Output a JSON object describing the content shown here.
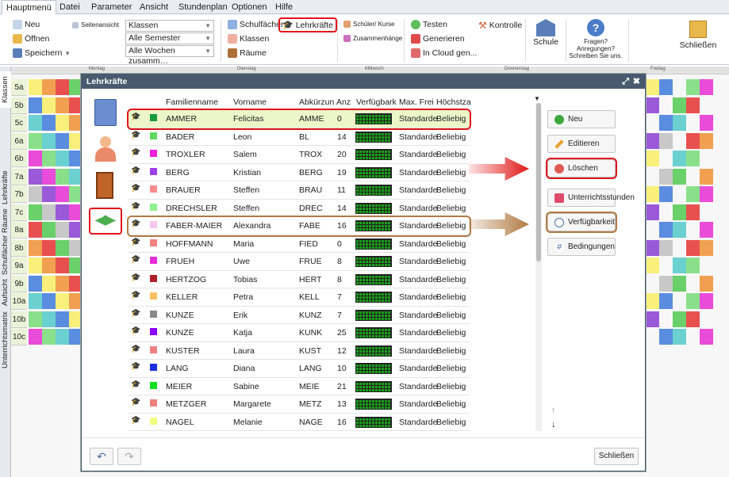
{
  "menubar": {
    "items": [
      "Hauptmenü",
      "Datei",
      "Parameter",
      "Ansicht",
      "Stundenplan",
      "Optionen",
      "Hilfe"
    ]
  },
  "ribbon": {
    "neu": "Neu",
    "seitenansicht": "Seitenansicht",
    "oeffnen": "Öffnen",
    "speichern": "Speichern",
    "select_view": "Klassen",
    "select_semester": "Alle Semester",
    "select_weeks": "Alle Wochen zusamm…",
    "schulfaecher": "Schulfächer",
    "lehrkraefte": "Lehrkräfte",
    "klassen": "Klassen",
    "raeume": "Räume",
    "schueler_kurse": "Schüler/ Kurse",
    "zusammenhaenge": "Zusammenhänge",
    "testen": "Testen",
    "generieren": "Generieren",
    "in_cloud": "In Cloud gen...",
    "kontrolle": "Kontrolle",
    "schule": "Schule",
    "fragen": "Fragen? Anregungen? Schreiben Sie uns.",
    "schliessen": "Schließen"
  },
  "days": [
    "Montag",
    "Dienstag",
    "Mittwoch",
    "Donnerstag",
    "Freitag"
  ],
  "side_tabs": [
    "Klassen",
    "Lehrkräfte",
    "Räume",
    "Schulfächer",
    "Aufsicht",
    "Unterrichtsmatrix"
  ],
  "classes": [
    "5a",
    "5b",
    "5c",
    "6a",
    "6b",
    "7a",
    "7b",
    "7c",
    "8a",
    "8b",
    "9a",
    "9b",
    "10a",
    "10b",
    "10c"
  ],
  "dialog": {
    "title": "Lehrkräfte",
    "columns": [
      "Familienname",
      "Vorname",
      "Abkürzun",
      "Anz",
      "Verfügbark",
      "Max. Frei",
      "Höchstza"
    ],
    "teachers": [
      {
        "last": "AMMER",
        "first": "Felicitas",
        "abbr": "AMME",
        "count": "0",
        "maxfrei": "Standarde",
        "hoechst": "Beliebig",
        "color": "#1a9a3a"
      },
      {
        "last": "BADER",
        "first": "Leon",
        "abbr": "BL",
        "count": "14",
        "maxfrei": "Standarde",
        "hoechst": "Beliebig",
        "color": "#5fd85f"
      },
      {
        "last": "TROXLER",
        "first": "Salem",
        "abbr": "TROX",
        "count": "20",
        "maxfrei": "Standarde",
        "hoechst": "Beliebig",
        "color": "#f01fe0"
      },
      {
        "last": "BERG",
        "first": "Kristian",
        "abbr": "BERG",
        "count": "19",
        "maxfrei": "Standarde",
        "hoechst": "Beliebig",
        "color": "#9c3fe8"
      },
      {
        "last": "BRAUER",
        "first": "Steffen",
        "abbr": "BRAU",
        "count": "11",
        "maxfrei": "Standarde",
        "hoechst": "Beliebig",
        "color": "#ff8a8a"
      },
      {
        "last": "DRECHSLER",
        "first": "Steffen",
        "abbr": "DREC",
        "count": "14",
        "maxfrei": "Standarde",
        "hoechst": "Beliebig",
        "color": "#8ef08e"
      },
      {
        "last": "FABER-MAIER",
        "first": "Alexandra",
        "abbr": "FABE",
        "count": "16",
        "maxfrei": "Standarde",
        "hoechst": "Beliebig",
        "color": "#f7c6ee"
      },
      {
        "last": "HOFFMANN",
        "first": "Maria",
        "abbr": "FIED",
        "count": "0",
        "maxfrei": "Standarde",
        "hoechst": "Beliebig",
        "color": "#f48080"
      },
      {
        "last": "FRUEH",
        "first": "Uwe",
        "abbr": "FRUE",
        "count": "8",
        "maxfrei": "Standarde",
        "hoechst": "Beliebig",
        "color": "#e42fd8"
      },
      {
        "last": "HERTZOG",
        "first": "Tobias",
        "abbr": "HERT",
        "count": "8",
        "maxfrei": "Standarde",
        "hoechst": "Beliebig",
        "color": "#b0202a"
      },
      {
        "last": "KELLER",
        "first": "Petra",
        "abbr": "KELL",
        "count": "7",
        "maxfrei": "Standarde",
        "hoechst": "Beliebig",
        "color": "#ffc062"
      },
      {
        "last": "KUNZE",
        "first": "Erik",
        "abbr": "KUNZ",
        "count": "7",
        "maxfrei": "Standarde",
        "hoechst": "Beliebig",
        "color": "#8a8a8a"
      },
      {
        "last": "KUNZE",
        "first": "Katja",
        "abbr": "KUNK",
        "count": "25",
        "maxfrei": "Standarde",
        "hoechst": "Beliebig",
        "color": "#8b00ff"
      },
      {
        "last": "KUSTER",
        "first": "Laura",
        "abbr": "KUST",
        "count": "12",
        "maxfrei": "Standarde",
        "hoechst": "Beliebig",
        "color": "#f08080"
      },
      {
        "last": "LANG",
        "first": "Diana",
        "abbr": "LANG",
        "count": "10",
        "maxfrei": "Standarde",
        "hoechst": "Beliebig",
        "color": "#1c2fe0"
      },
      {
        "last": "MEIER",
        "first": "Sabine",
        "abbr": "MEIE",
        "count": "21",
        "maxfrei": "Standarde",
        "hoechst": "Beliebig",
        "color": "#10e020"
      },
      {
        "last": "METZGER",
        "first": "Margarete",
        "abbr": "METZ",
        "count": "13",
        "maxfrei": "Standarde",
        "hoechst": "Beliebig",
        "color": "#f08080"
      },
      {
        "last": "NAGEL",
        "first": "Melanie",
        "abbr": "NAGE",
        "count": "16",
        "maxfrei": "Standarde",
        "hoechst": "Beliebig",
        "color": "#f0ff80"
      }
    ],
    "buttons": {
      "neu": "Neu",
      "editieren": "Editieren",
      "loeschen": "Löschen",
      "unterrichtsstunden": "Unterrichtsstunden",
      "verfuegbarkeit": "Verfügbarkeit",
      "bedingungen": "Bedingungen",
      "schliessen": "Schließen"
    },
    "highlight_colors": {
      "red": "#e0141a",
      "brown": "#b07a45",
      "selected_row": "#ecf6c9"
    }
  }
}
